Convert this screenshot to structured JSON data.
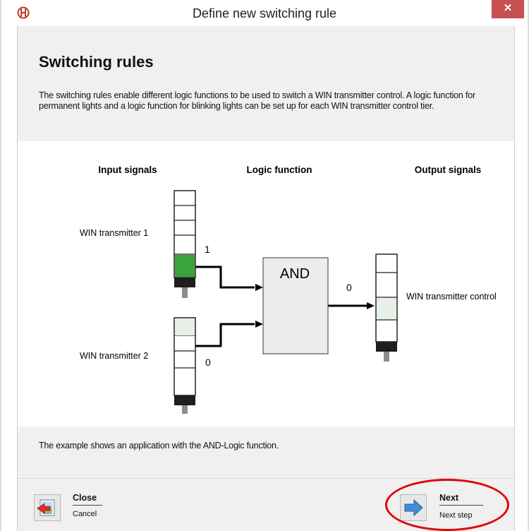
{
  "window": {
    "title": "Define new switching rule",
    "close_glyph": "✕"
  },
  "main": {
    "heading": "Switching rules",
    "description": "The switching rules enable different logic functions to be used to switch a WIN transmitter control. A logic function for permanent lights and a logic function for blinking lights can be set up for each WIN transmitter control tier.",
    "footnote": "The example shows an application with the AND-Logic function."
  },
  "diagram": {
    "col_input": "Input signals",
    "col_logic": "Logic function",
    "col_output": "Output signals",
    "input1_label": "WIN transmitter 1",
    "input1_value": "1",
    "input2_label": "WIN transmitter 2",
    "input2_value": "0",
    "gate_label": "AND",
    "output_value": "0",
    "output_label": "WIN transmitter control",
    "colors": {
      "lamp_on": "#3aa33a",
      "lamp_dim": "#e6f0e6",
      "lamp_off": "#ffffff",
      "gate_fill": "#ececec"
    }
  },
  "footer": {
    "close_label": "Close",
    "close_sub": "Cancel",
    "next_label": "Next",
    "next_sub": "Next step"
  },
  "annotation": {
    "color": "#e00000"
  }
}
